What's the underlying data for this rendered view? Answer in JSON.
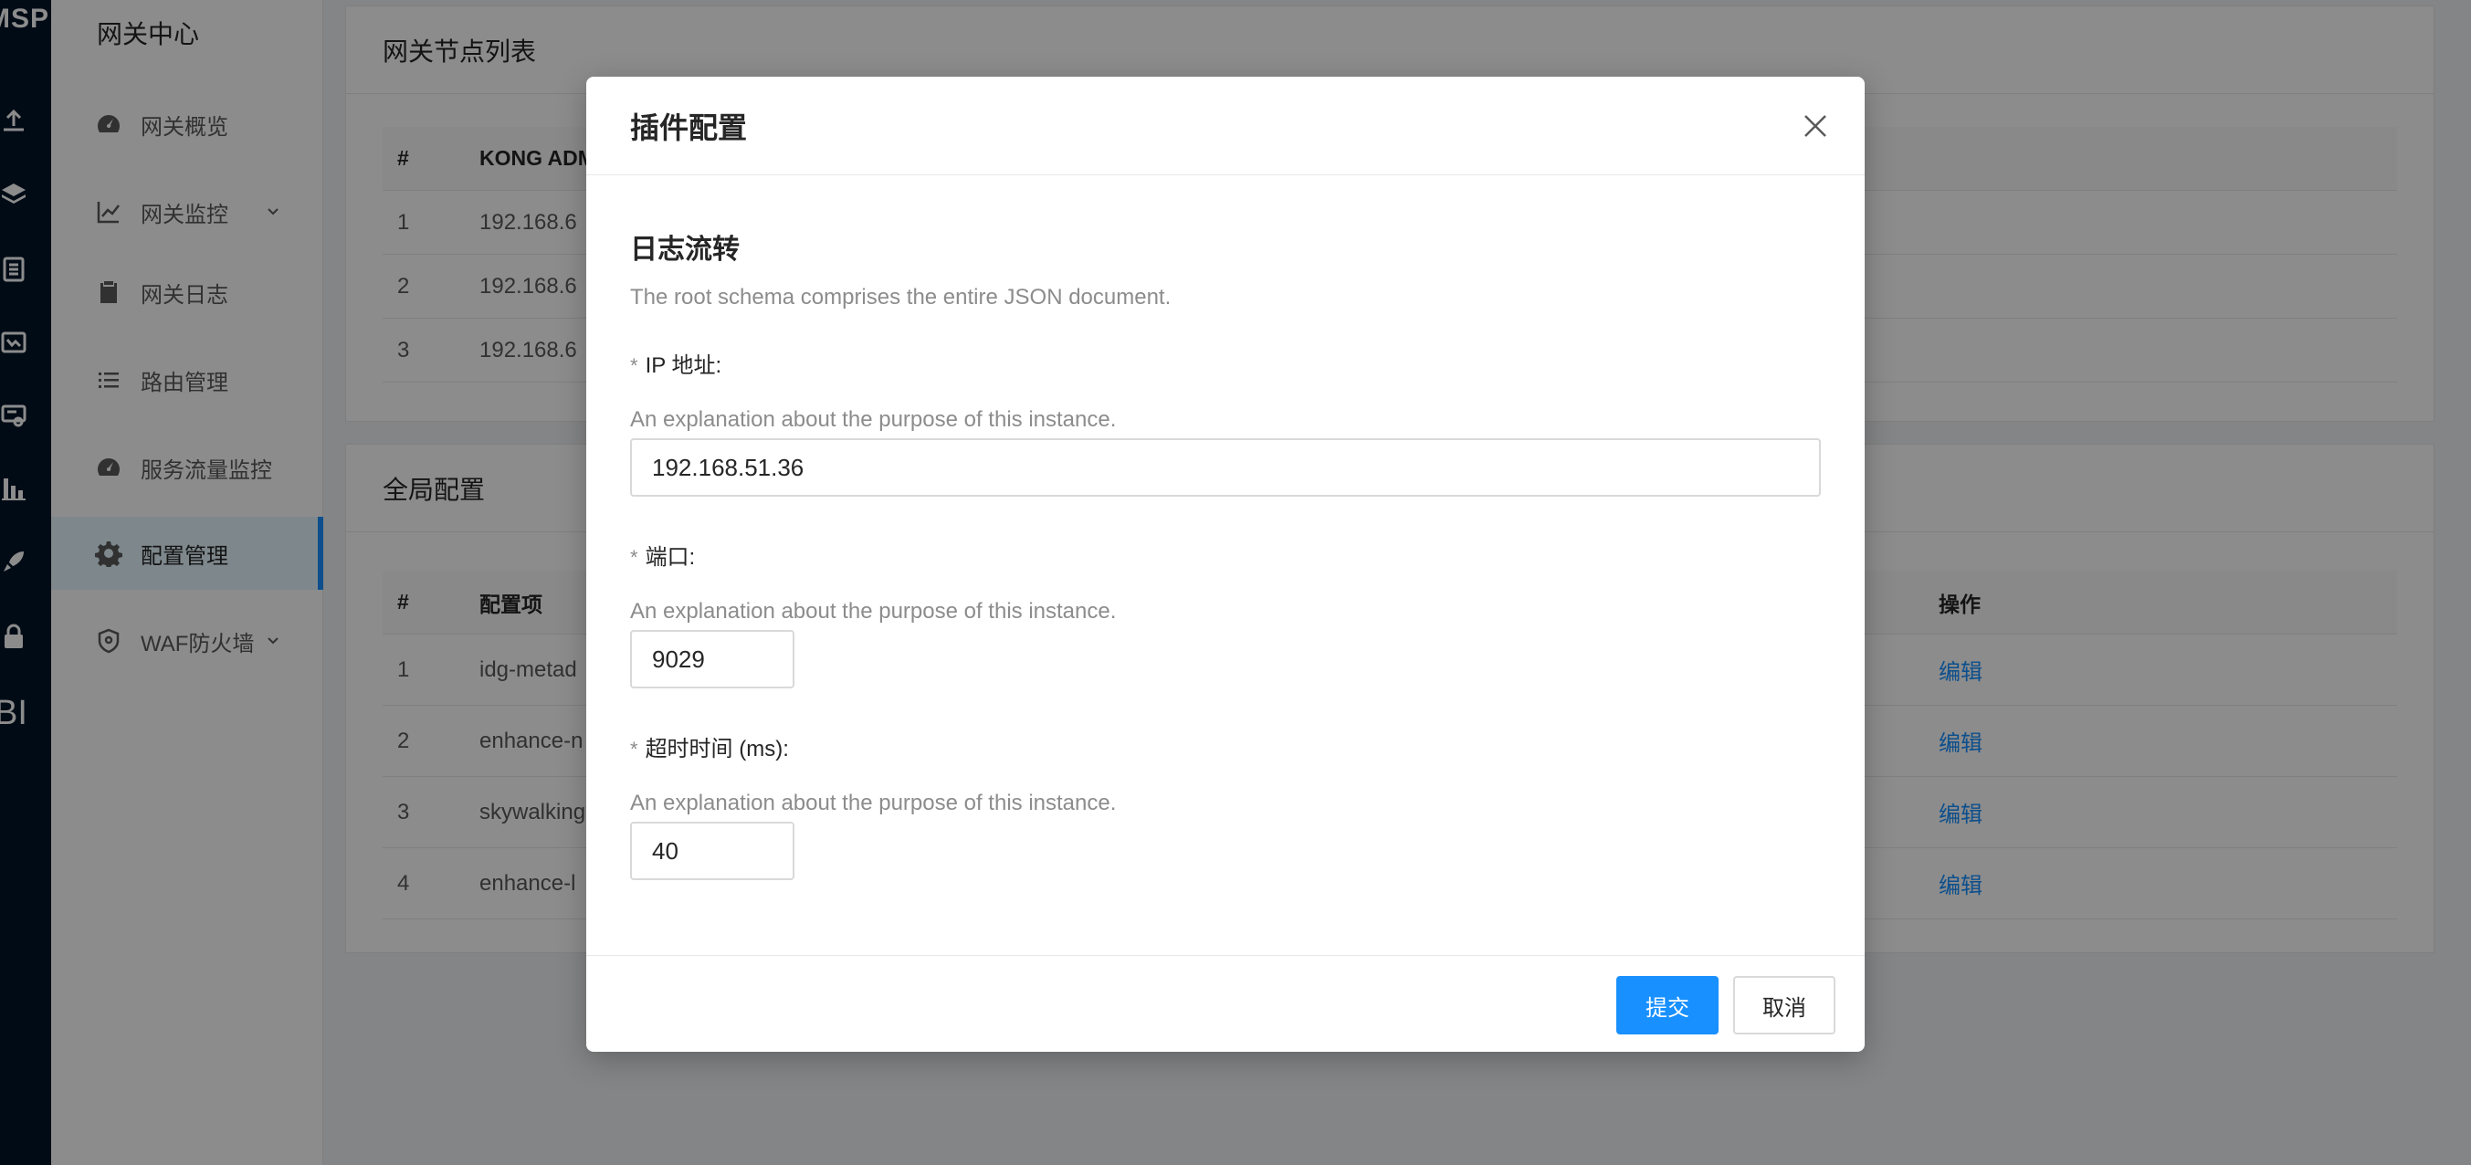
{
  "rail": {
    "logo": "MSP",
    "bi": "BI",
    "icons": [
      "upload-icon",
      "layers-icon",
      "document-icon",
      "monitor-icon",
      "certificate-icon",
      "bar-chart-icon",
      "rocket-icon",
      "lock-icon"
    ]
  },
  "submenu": {
    "title": "网关中心",
    "items": [
      {
        "label": "网关概览",
        "icon": "dashboard-icon"
      },
      {
        "label": "网关监控",
        "icon": "line-chart-icon"
      },
      {
        "label": "网关日志",
        "icon": "clipboard-icon"
      },
      {
        "label": "路由管理",
        "icon": "list-icon"
      },
      {
        "label": "服务流量监控",
        "icon": "dashboard-icon"
      },
      {
        "label": "配置管理",
        "icon": "gear-icon"
      },
      {
        "label": "WAF防火墙",
        "icon": "shield-icon"
      }
    ]
  },
  "nodes_card": {
    "title": "网关节点列表",
    "columns": [
      "#",
      "KONG ADM"
    ],
    "rows": [
      {
        "idx": "1",
        "value": "192.168.6"
      },
      {
        "idx": "2",
        "value": "192.168.6"
      },
      {
        "idx": "3",
        "value": "192.168.6"
      }
    ]
  },
  "global_card": {
    "title": "全局配置",
    "columns": [
      "#",
      "配置项",
      "操作"
    ],
    "rows": [
      {
        "idx": "1",
        "value": "idg-metad",
        "op": "编辑"
      },
      {
        "idx": "2",
        "value": "enhance-n",
        "op": "编辑"
      },
      {
        "idx": "3",
        "value": "skywalking",
        "op": "编辑"
      },
      {
        "idx": "4",
        "value": "enhance-l",
        "op": "编辑"
      }
    ]
  },
  "modal": {
    "title": "插件配置",
    "schema_title": "日志流转",
    "schema_desc": "The root schema comprises the entire JSON document.",
    "required_mark": "*",
    "fields": [
      {
        "label": "IP 地址:",
        "desc": "An explanation about the purpose of this instance.",
        "value": "192.168.51.36"
      },
      {
        "label": "端口:",
        "desc": "An explanation about the purpose of this instance.",
        "value": "9029"
      },
      {
        "label": "超时时间 (ms):",
        "desc": "An explanation about the purpose of this instance.",
        "value": "40"
      }
    ],
    "submit_label": "提交",
    "cancel_label": "取消"
  },
  "colors": {
    "primary": "#1890ff",
    "rail_bg": "#001529",
    "mask": "rgba(0,0,0,0.45)"
  }
}
